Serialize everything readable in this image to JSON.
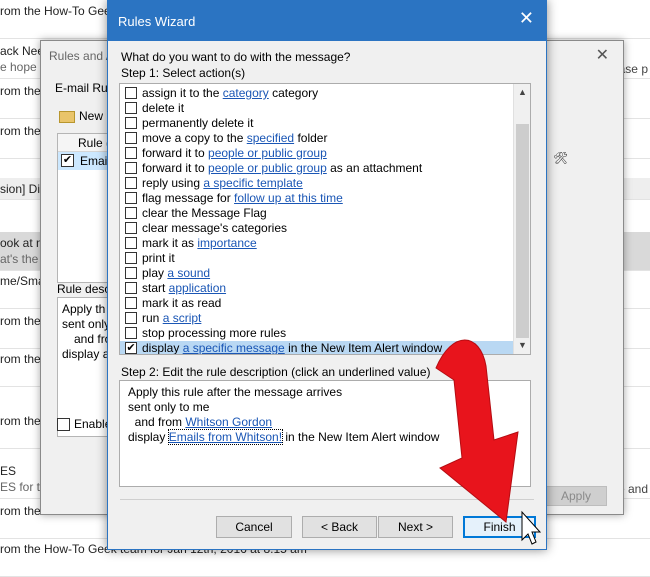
{
  "background_list": {
    "rows": [
      {
        "title": "rom the How-To Gee",
        "sub": ""
      },
      {
        "title": "ack Nee",
        "sub": "e hope"
      },
      {
        "title": "rom the",
        "sub": ""
      },
      {
        "title": "rom the",
        "sub": ""
      },
      {
        "title": "sion] Di",
        "sub": ""
      },
      {
        "title": "ook at m",
        "sub": "at's the"
      },
      {
        "title": "me/Sma",
        "sub": ""
      },
      {
        "title": "rom the",
        "sub": ""
      },
      {
        "title": "rom the",
        "sub": ""
      },
      {
        "title": "rom the",
        "sub": ""
      },
      {
        "title": "ES",
        "sub": "ES for th"
      },
      {
        "title": "rom the How-To Gee",
        "sub": ""
      },
      {
        "title": "rom the How-To Geek team for Jan 12th, 2016 at 8:15 am",
        "sub": ""
      }
    ],
    "right_text_1": "lease p",
    "right_text_2": "ple and"
  },
  "rules_alerts": {
    "title": "Rules and A",
    "tab": "E-mail Rule",
    "new_rule": "New R",
    "list_header": "Rule (",
    "list_row": "Emails",
    "desc_label": "Rule descr",
    "desc_lines": [
      "Apply th",
      "sent only",
      "  and fro",
      "display a"
    ],
    "enable": "Enable",
    "apply": "Apply"
  },
  "wizard": {
    "title": "Rules Wizard",
    "question": "What do you want to do with the message?",
    "step1": "Step 1: Select action(s)",
    "actions": [
      {
        "pre": "assign it to the ",
        "link": "category",
        "post": " category",
        "checked": false
      },
      {
        "pre": "delete it",
        "link": "",
        "post": "",
        "checked": false
      },
      {
        "pre": "permanently delete it",
        "link": "",
        "post": "",
        "checked": false
      },
      {
        "pre": "move a copy to the ",
        "link": "specified",
        "post": " folder",
        "checked": false
      },
      {
        "pre": "forward it to ",
        "link": "people or public group",
        "post": "",
        "checked": false
      },
      {
        "pre": "forward it to ",
        "link": "people or public group",
        "post": " as an attachment",
        "checked": false
      },
      {
        "pre": "reply using ",
        "link": "a specific template",
        "post": "",
        "checked": false
      },
      {
        "pre": "flag message for ",
        "link": "follow up at this time",
        "post": "",
        "checked": false
      },
      {
        "pre": "clear the Message Flag",
        "link": "",
        "post": "",
        "checked": false
      },
      {
        "pre": "clear message's categories",
        "link": "",
        "post": "",
        "checked": false
      },
      {
        "pre": "mark it as ",
        "link": "importance",
        "post": "",
        "checked": false
      },
      {
        "pre": "print it",
        "link": "",
        "post": "",
        "checked": false
      },
      {
        "pre": "play ",
        "link": "a sound",
        "post": "",
        "checked": false
      },
      {
        "pre": "start ",
        "link": "application",
        "post": "",
        "checked": false
      },
      {
        "pre": "mark it as read",
        "link": "",
        "post": "",
        "checked": false
      },
      {
        "pre": "run ",
        "link": "a script",
        "post": "",
        "checked": false
      },
      {
        "pre": "stop processing more rules",
        "link": "",
        "post": "",
        "checked": false
      },
      {
        "pre": "display ",
        "link": "a specific message",
        "post": " in the New Item Alert window",
        "checked": true
      }
    ],
    "step2": "Step 2: Edit the rule description (click an underlined value)",
    "description": {
      "line1": "Apply this rule after the message arrives",
      "line2": "sent only to me",
      "line3_pre": "  and from ",
      "line3_link": "Whitson Gordon",
      "line4_pre": "display ",
      "line4_link": "Emails from Whitson!",
      "line4_post": " in the New Item Alert window"
    },
    "buttons": {
      "cancel": "Cancel",
      "back": "< Back",
      "next": "Next >",
      "finish": "Finish"
    }
  },
  "colors": {
    "titlebar": "#2b74c2",
    "link": "#1a56b5",
    "selected_row": "#b9d8f3",
    "arrow": "#e8141c"
  }
}
